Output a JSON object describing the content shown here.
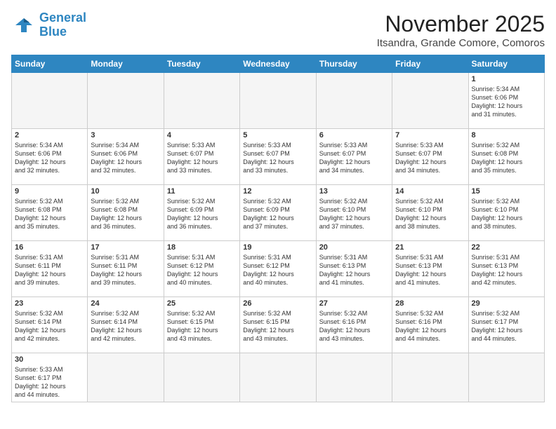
{
  "header": {
    "logo_general": "General",
    "logo_blue": "Blue",
    "month": "November 2025",
    "location": "Itsandra, Grande Comore, Comoros"
  },
  "days_of_week": [
    "Sunday",
    "Monday",
    "Tuesday",
    "Wednesday",
    "Thursday",
    "Friday",
    "Saturday"
  ],
  "weeks": [
    [
      {
        "day": "",
        "info": ""
      },
      {
        "day": "",
        "info": ""
      },
      {
        "day": "",
        "info": ""
      },
      {
        "day": "",
        "info": ""
      },
      {
        "day": "",
        "info": ""
      },
      {
        "day": "",
        "info": ""
      },
      {
        "day": "1",
        "info": "Sunrise: 5:34 AM\nSunset: 6:06 PM\nDaylight: 12 hours\nand 31 minutes."
      }
    ],
    [
      {
        "day": "2",
        "info": "Sunrise: 5:34 AM\nSunset: 6:06 PM\nDaylight: 12 hours\nand 32 minutes."
      },
      {
        "day": "3",
        "info": "Sunrise: 5:34 AM\nSunset: 6:06 PM\nDaylight: 12 hours\nand 32 minutes."
      },
      {
        "day": "4",
        "info": "Sunrise: 5:33 AM\nSunset: 6:07 PM\nDaylight: 12 hours\nand 33 minutes."
      },
      {
        "day": "5",
        "info": "Sunrise: 5:33 AM\nSunset: 6:07 PM\nDaylight: 12 hours\nand 33 minutes."
      },
      {
        "day": "6",
        "info": "Sunrise: 5:33 AM\nSunset: 6:07 PM\nDaylight: 12 hours\nand 34 minutes."
      },
      {
        "day": "7",
        "info": "Sunrise: 5:33 AM\nSunset: 6:07 PM\nDaylight: 12 hours\nand 34 minutes."
      },
      {
        "day": "8",
        "info": "Sunrise: 5:32 AM\nSunset: 6:08 PM\nDaylight: 12 hours\nand 35 minutes."
      }
    ],
    [
      {
        "day": "9",
        "info": "Sunrise: 5:32 AM\nSunset: 6:08 PM\nDaylight: 12 hours\nand 35 minutes."
      },
      {
        "day": "10",
        "info": "Sunrise: 5:32 AM\nSunset: 6:08 PM\nDaylight: 12 hours\nand 36 minutes."
      },
      {
        "day": "11",
        "info": "Sunrise: 5:32 AM\nSunset: 6:09 PM\nDaylight: 12 hours\nand 36 minutes."
      },
      {
        "day": "12",
        "info": "Sunrise: 5:32 AM\nSunset: 6:09 PM\nDaylight: 12 hours\nand 37 minutes."
      },
      {
        "day": "13",
        "info": "Sunrise: 5:32 AM\nSunset: 6:10 PM\nDaylight: 12 hours\nand 37 minutes."
      },
      {
        "day": "14",
        "info": "Sunrise: 5:32 AM\nSunset: 6:10 PM\nDaylight: 12 hours\nand 38 minutes."
      },
      {
        "day": "15",
        "info": "Sunrise: 5:32 AM\nSunset: 6:10 PM\nDaylight: 12 hours\nand 38 minutes."
      }
    ],
    [
      {
        "day": "16",
        "info": "Sunrise: 5:31 AM\nSunset: 6:11 PM\nDaylight: 12 hours\nand 39 minutes."
      },
      {
        "day": "17",
        "info": "Sunrise: 5:31 AM\nSunset: 6:11 PM\nDaylight: 12 hours\nand 39 minutes."
      },
      {
        "day": "18",
        "info": "Sunrise: 5:31 AM\nSunset: 6:12 PM\nDaylight: 12 hours\nand 40 minutes."
      },
      {
        "day": "19",
        "info": "Sunrise: 5:31 AM\nSunset: 6:12 PM\nDaylight: 12 hours\nand 40 minutes."
      },
      {
        "day": "20",
        "info": "Sunrise: 5:31 AM\nSunset: 6:13 PM\nDaylight: 12 hours\nand 41 minutes."
      },
      {
        "day": "21",
        "info": "Sunrise: 5:31 AM\nSunset: 6:13 PM\nDaylight: 12 hours\nand 41 minutes."
      },
      {
        "day": "22",
        "info": "Sunrise: 5:31 AM\nSunset: 6:13 PM\nDaylight: 12 hours\nand 42 minutes."
      }
    ],
    [
      {
        "day": "23",
        "info": "Sunrise: 5:32 AM\nSunset: 6:14 PM\nDaylight: 12 hours\nand 42 minutes."
      },
      {
        "day": "24",
        "info": "Sunrise: 5:32 AM\nSunset: 6:14 PM\nDaylight: 12 hours\nand 42 minutes."
      },
      {
        "day": "25",
        "info": "Sunrise: 5:32 AM\nSunset: 6:15 PM\nDaylight: 12 hours\nand 43 minutes."
      },
      {
        "day": "26",
        "info": "Sunrise: 5:32 AM\nSunset: 6:15 PM\nDaylight: 12 hours\nand 43 minutes."
      },
      {
        "day": "27",
        "info": "Sunrise: 5:32 AM\nSunset: 6:16 PM\nDaylight: 12 hours\nand 43 minutes."
      },
      {
        "day": "28",
        "info": "Sunrise: 5:32 AM\nSunset: 6:16 PM\nDaylight: 12 hours\nand 44 minutes."
      },
      {
        "day": "29",
        "info": "Sunrise: 5:32 AM\nSunset: 6:17 PM\nDaylight: 12 hours\nand 44 minutes."
      }
    ],
    [
      {
        "day": "30",
        "info": "Sunrise: 5:33 AM\nSunset: 6:17 PM\nDaylight: 12 hours\nand 44 minutes."
      },
      {
        "day": "",
        "info": ""
      },
      {
        "day": "",
        "info": ""
      },
      {
        "day": "",
        "info": ""
      },
      {
        "day": "",
        "info": ""
      },
      {
        "day": "",
        "info": ""
      },
      {
        "day": "",
        "info": ""
      }
    ]
  ]
}
